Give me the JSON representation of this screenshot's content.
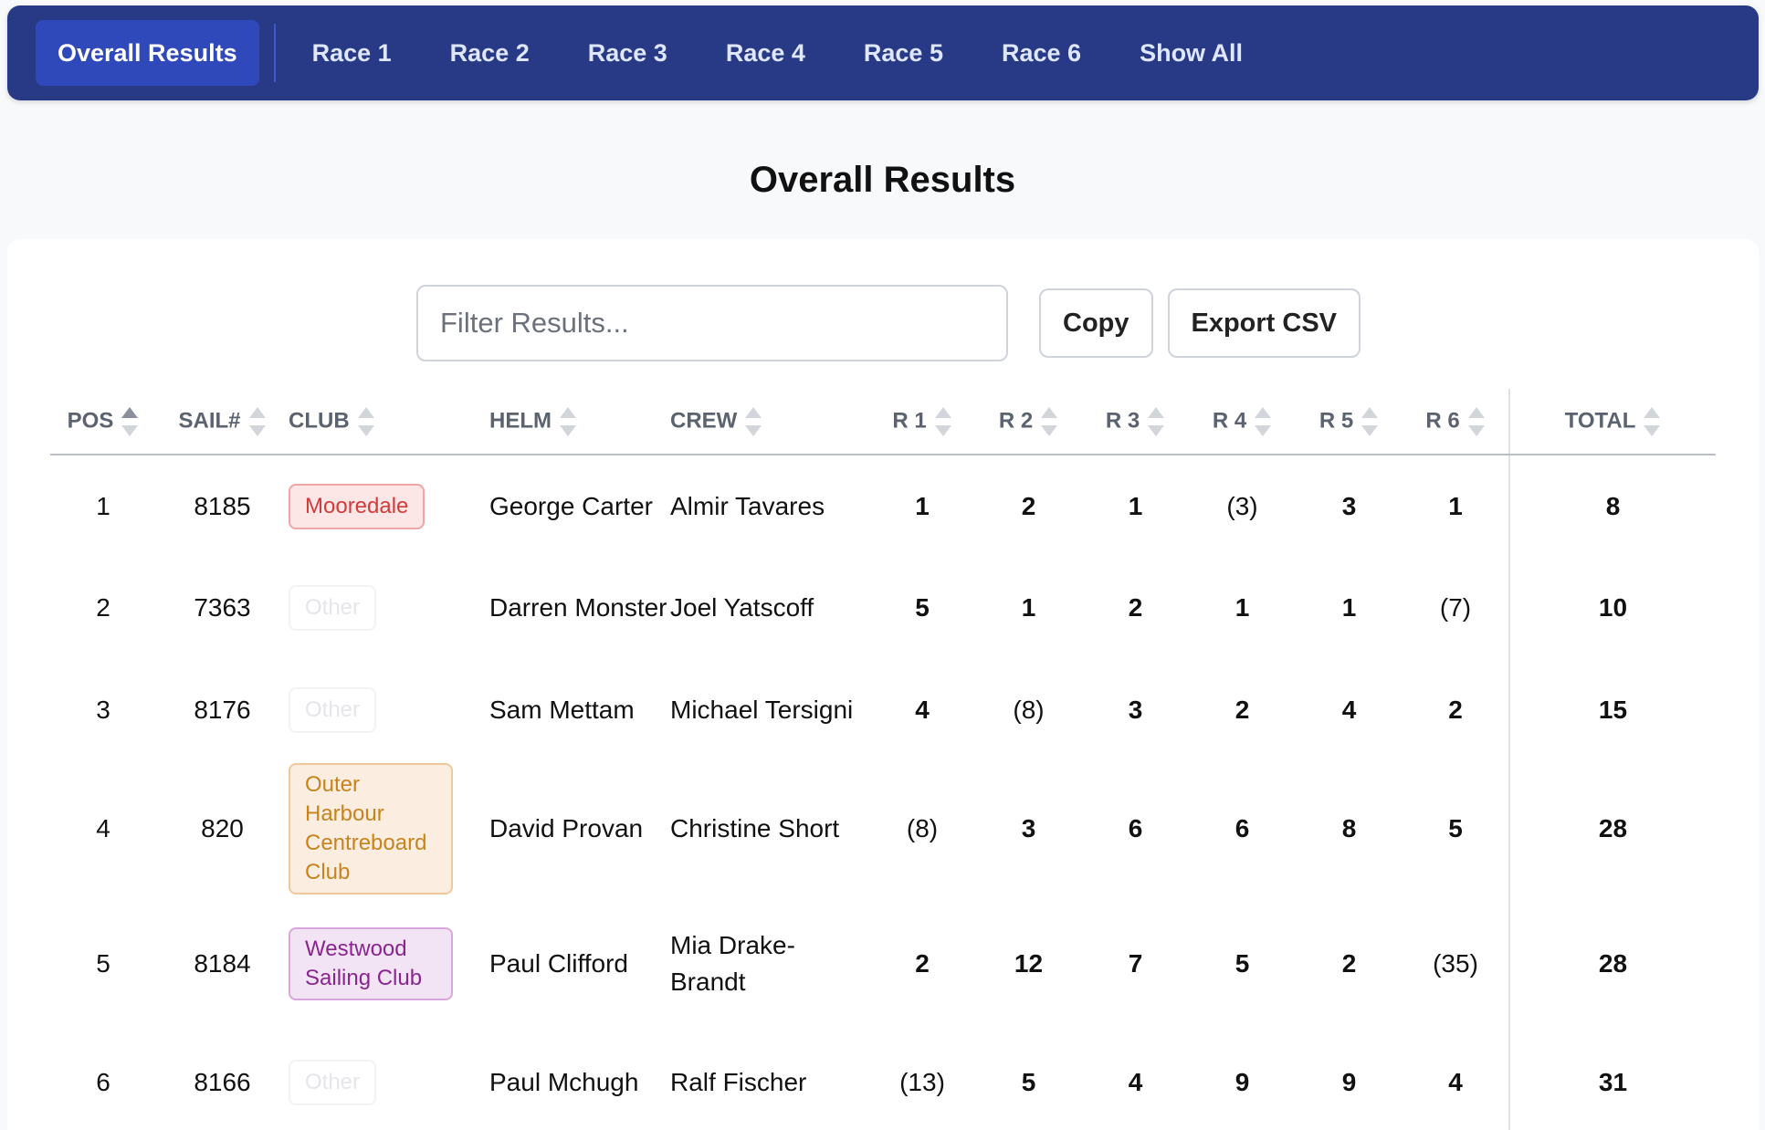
{
  "nav": {
    "tabs": [
      {
        "label": "Overall Results",
        "active": true
      },
      {
        "label": "Race 1"
      },
      {
        "label": "Race 2"
      },
      {
        "label": "Race 3"
      },
      {
        "label": "Race 4"
      },
      {
        "label": "Race 5"
      },
      {
        "label": "Race 6"
      },
      {
        "label": "Show All"
      }
    ]
  },
  "page": {
    "title": "Overall Results"
  },
  "toolbar": {
    "filter_placeholder": "Filter Results...",
    "filter_value": "",
    "copy_label": "Copy",
    "export_label": "Export CSV"
  },
  "table": {
    "headers": {
      "pos": "POS",
      "sail": "SAIL#",
      "club": "CLUB",
      "helm": "HELM",
      "crew": "CREW",
      "r1": "R 1",
      "r2": "R 2",
      "r3": "R 3",
      "r4": "R 4",
      "r5": "R 5",
      "r6": "R 6",
      "total": "TOTAL"
    },
    "rows": [
      {
        "pos": "1",
        "sail": "8185",
        "club": "Mooredale",
        "helm": "George Carter",
        "crew": "Almir Tavares",
        "r1": "1",
        "r2": "2",
        "r3": "1",
        "r4": "(3)",
        "r5": "3",
        "r6": "1",
        "total": "8"
      },
      {
        "pos": "2",
        "sail": "7363",
        "club": "Other",
        "helm": "Darren Monster",
        "crew": "Joel Yatscoff",
        "r1": "5",
        "r2": "1",
        "r3": "2",
        "r4": "1",
        "r5": "1",
        "r6": "(7)",
        "total": "10"
      },
      {
        "pos": "3",
        "sail": "8176",
        "club": "Other",
        "helm": "Sam Mettam",
        "crew": "Michael Tersigni",
        "r1": "4",
        "r2": "(8)",
        "r3": "3",
        "r4": "2",
        "r5": "4",
        "r6": "2",
        "total": "15"
      },
      {
        "pos": "4",
        "sail": "820",
        "club": "Outer Harbour Centreboard Club",
        "helm": "David Provan",
        "crew": "Christine Short",
        "r1": "(8)",
        "r2": "3",
        "r3": "6",
        "r4": "6",
        "r5": "8",
        "r6": "5",
        "total": "28"
      },
      {
        "pos": "5",
        "sail": "8184",
        "club": "Westwood Sailing Club",
        "helm": "Paul Clifford",
        "crew": "Mia Drake-Brandt",
        "r1": "2",
        "r2": "12",
        "r3": "7",
        "r4": "5",
        "r5": "2",
        "r6": "(35)",
        "total": "28"
      },
      {
        "pos": "6",
        "sail": "8166",
        "club": "Other",
        "helm": "Paul Mchugh",
        "crew": "Ralf Fischer",
        "r1": "(13)",
        "r2": "5",
        "r3": "4",
        "r4": "9",
        "r5": "9",
        "r6": "4",
        "total": "31"
      }
    ]
  }
}
